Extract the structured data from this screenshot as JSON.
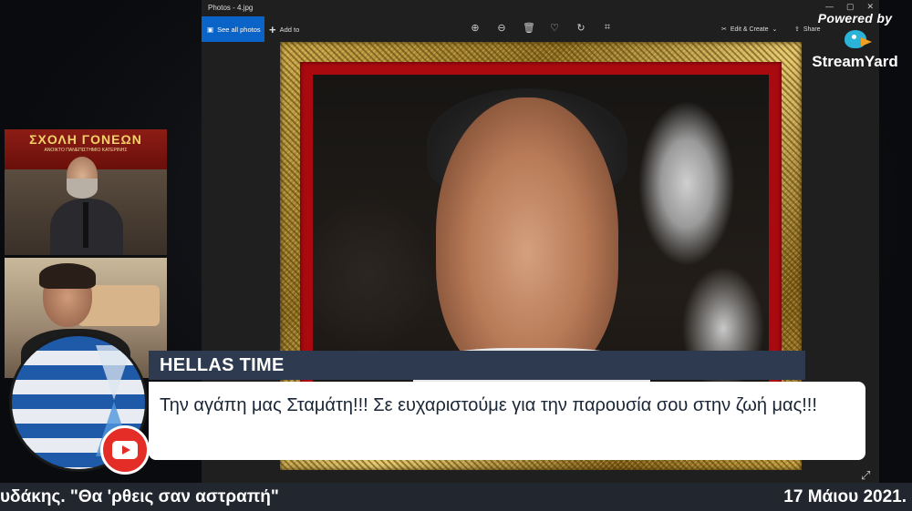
{
  "photos_app": {
    "window_title": "Photos - 4.jpg",
    "see_all_photos_label": "See all photos",
    "add_to_label": "Add to",
    "edit_create_label": "Edit & Create",
    "share_label": "Share",
    "toolbar_icons": [
      "zoom-in-icon",
      "zoom-out-icon",
      "delete-icon",
      "favorite-icon",
      "rotate-icon",
      "crop-icon"
    ],
    "window_controls": [
      "minimize-icon",
      "maximize-icon",
      "close-icon"
    ]
  },
  "streamyard": {
    "powered_by": "Powered by",
    "brand": "StreamYard",
    "accent_color": "#2bb3d8"
  },
  "camera_top": {
    "banner_line1": "ΣΧΟΛΗ ΓΟΝΕΩΝ",
    "banner_line2": "ΑΝΟΙΚΤΟ ΠΑΝΕΠΙΣΤΗΜΙΟ ΚΑΤΕΡΙΝΗΣ"
  },
  "comment": {
    "author": "HELLAS TIME",
    "text": "Την αγάπη μας Σταμάτη!!! Σε ευχαριστούμε για την παρουσία σου στην ζωή μας!!!",
    "name_bar_color": "#2e3a4f"
  },
  "ticker": {
    "left_text": "υδάκης. \"Θα 'ρθεις σαν αστραπή\"",
    "right_text": "17 Μάιου 2021."
  }
}
